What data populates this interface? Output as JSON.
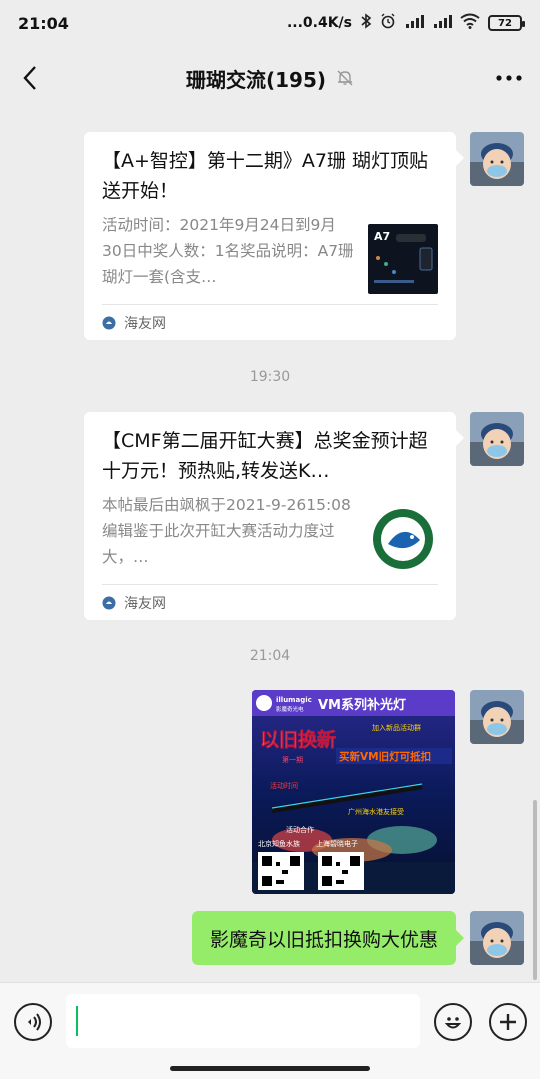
{
  "status_bar": {
    "time": "21:04",
    "net_speed": "...0.4K/s",
    "battery": "72"
  },
  "header": {
    "title": "珊瑚交流(195)"
  },
  "messages": [
    {
      "title": "【A+智控】第十二期》A7珊 瑚灯顶贴送开始！",
      "desc": "活动时间：2021年9月24日到9月30日中奖人数：1名奖品说明：A7珊瑚灯一套(含支…",
      "source": "海友网",
      "thumb_text": "A7"
    },
    {
      "title": "【CMF第二届开缸大赛】总奖金预计超十万元！预热贴,转发送K…",
      "desc": "本帖最后由飒枫于2021-9-2615:08编辑鉴于此次开缸大赛活动力度过大，…",
      "source": "海友网"
    }
  ],
  "timestamps": [
    "19:30",
    "21:04"
  ],
  "image_message": {
    "brand": "illumagic",
    "brand_cn": "影魔奇光电",
    "headline": "VM系列补光灯",
    "promo_top": "加入新品活动群",
    "trade": "以旧换新",
    "issue": "第一期",
    "subline": "买新VM旧灯可抵扣",
    "active": "活动时间",
    "partner_line": "广州海水港友接受",
    "contact": "活动合作",
    "dealer_1": "北京知鱼水族",
    "dealer_2": "上海碧晓电子"
  },
  "text_message": "影魔奇以旧抵扣换购大优惠",
  "colors": {
    "background": "#ededed",
    "self_bubble": "#95ec69",
    "accent": "#07c160"
  }
}
